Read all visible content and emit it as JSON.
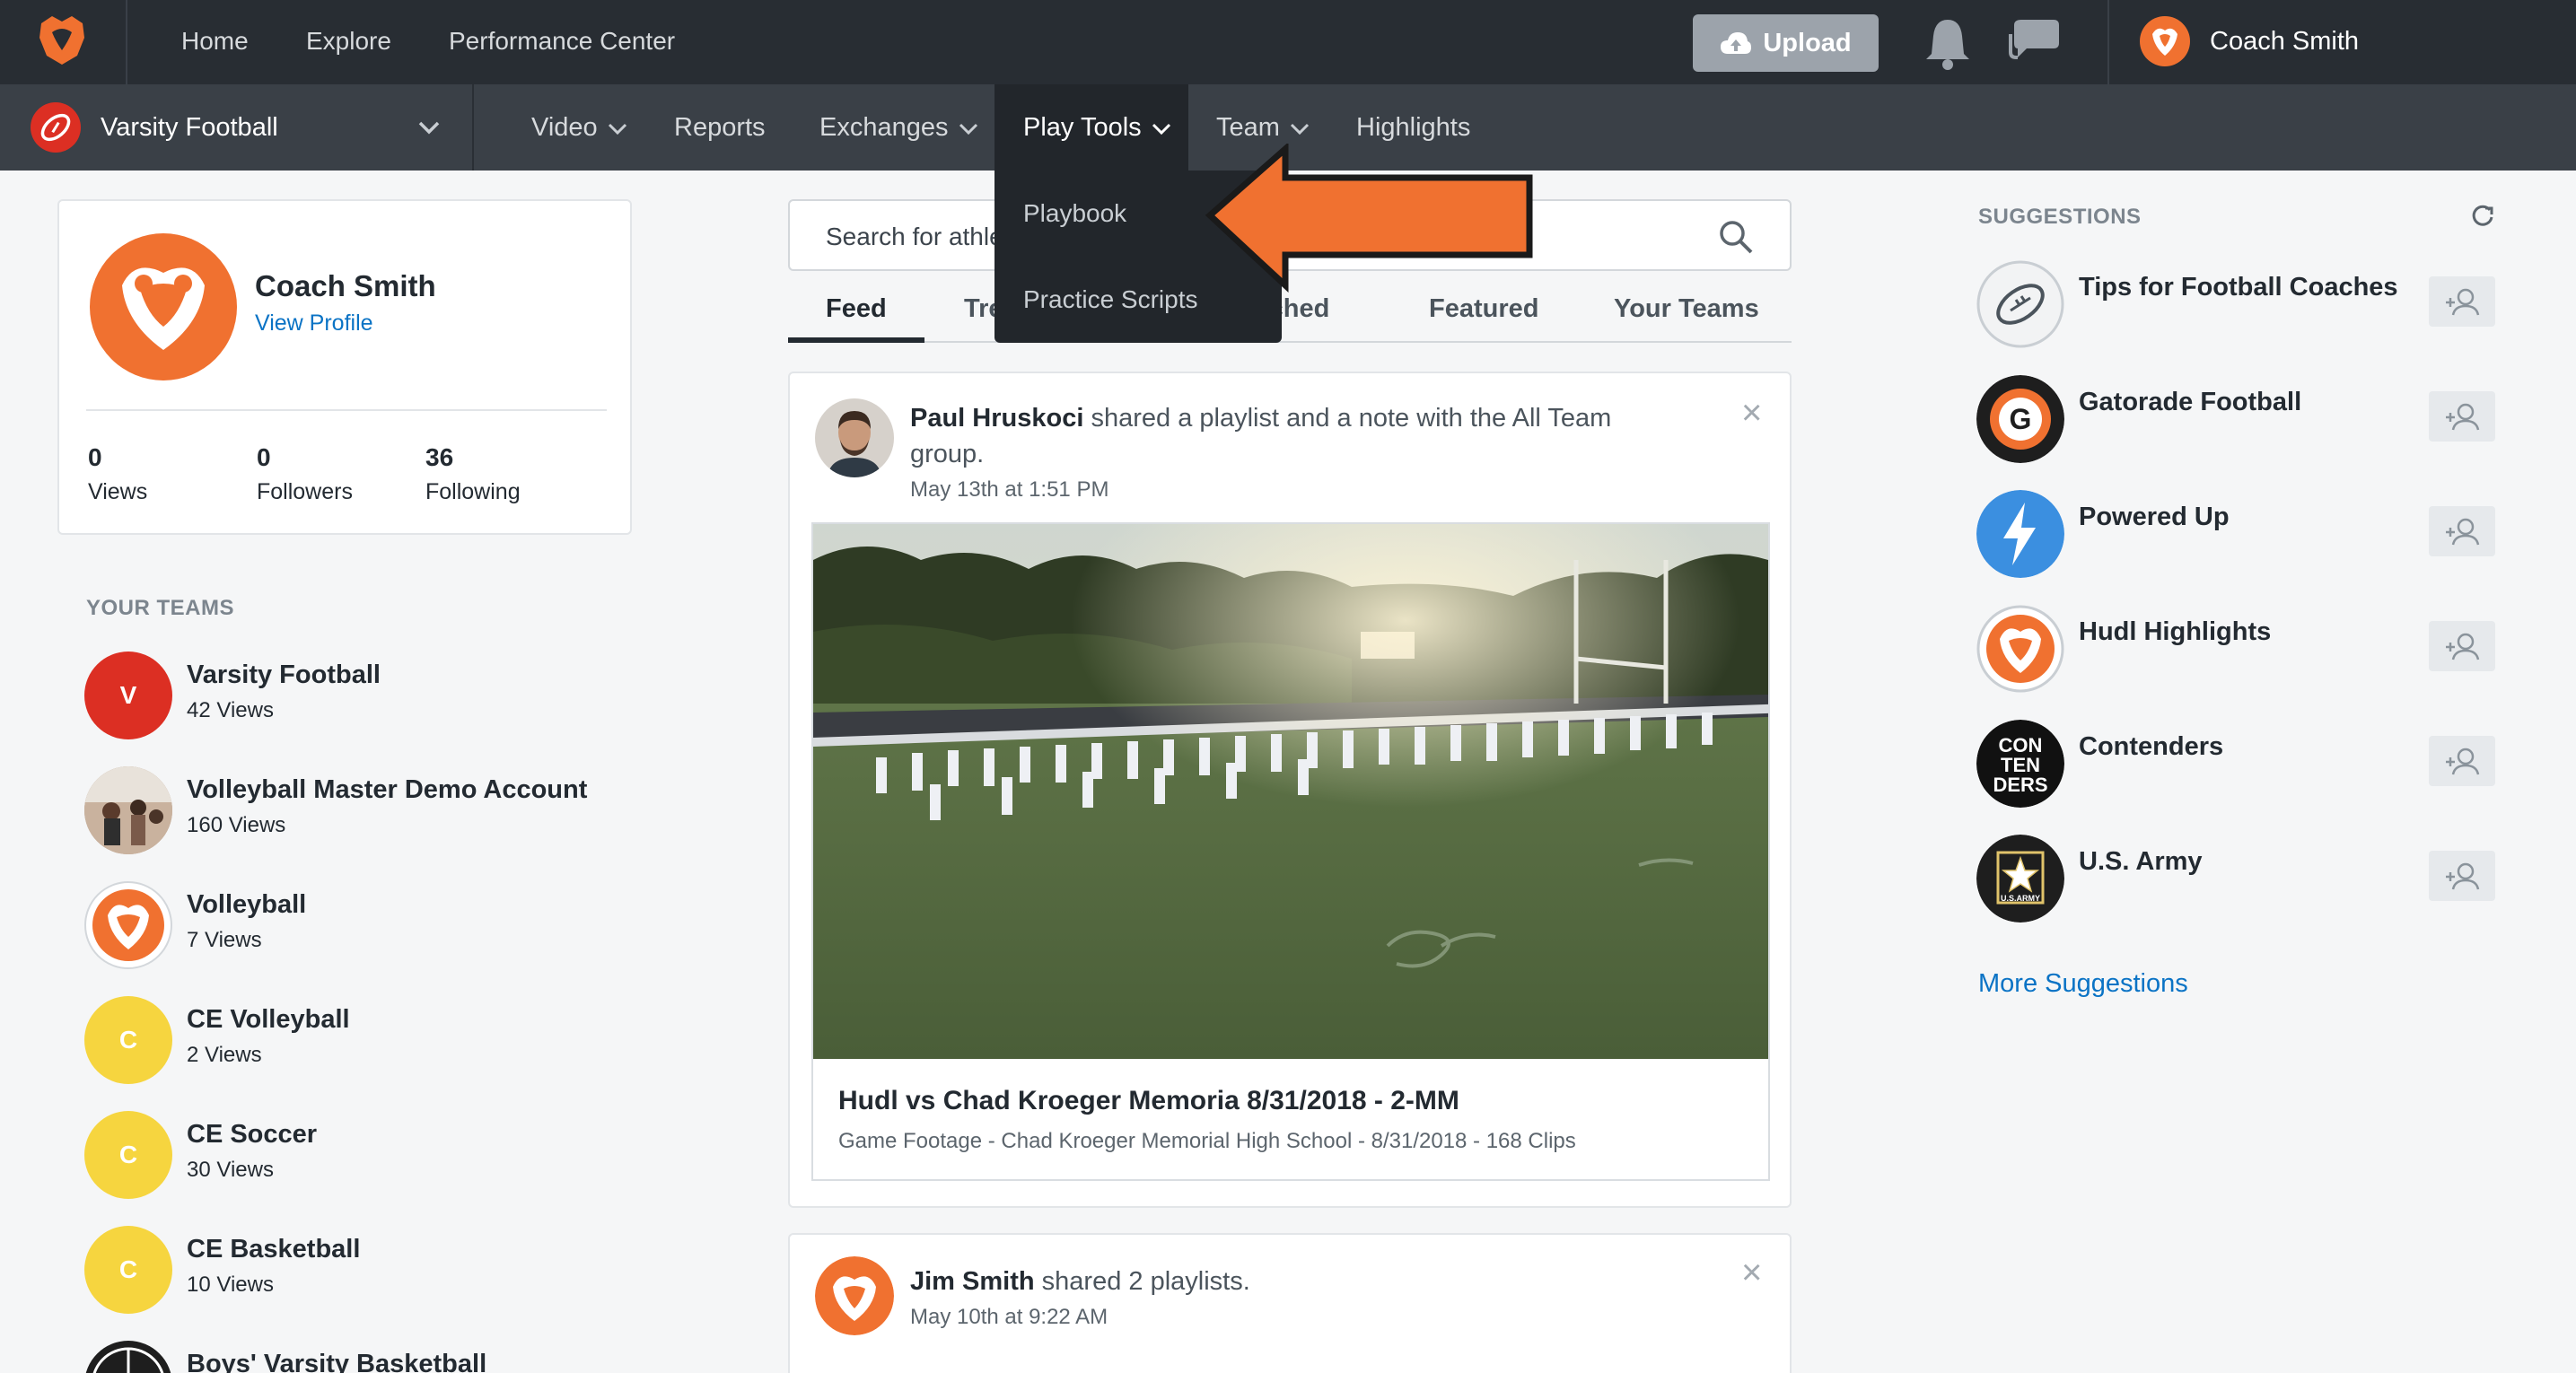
{
  "topbar": {
    "nav": [
      "Home",
      "Explore",
      "Performance Center"
    ],
    "upload_label": "Upload",
    "user_name": "Coach Smith"
  },
  "subnav": {
    "team": "Varsity Football",
    "items": [
      "Video",
      "Reports",
      "Exchanges",
      "Play Tools",
      "Team",
      "Highlights"
    ],
    "active": "Play Tools"
  },
  "dropdown": {
    "items": [
      "Playbook",
      "Practice Scripts"
    ]
  },
  "annotation": {
    "arrow_color": "#f07130"
  },
  "profile": {
    "name": "Coach Smith",
    "link": "View Profile",
    "stats": [
      {
        "value": "0",
        "label": "Views"
      },
      {
        "value": "0",
        "label": "Followers"
      },
      {
        "value": "36",
        "label": "Following"
      }
    ]
  },
  "your_teams": {
    "title": "YOUR TEAMS",
    "items": [
      {
        "name": "Varsity Football",
        "views": "42 Views",
        "initial": "V",
        "color": "#dc2f23"
      },
      {
        "name": "Volleyball Master Demo Account",
        "views": "160 Views",
        "initial": "",
        "color": "#b89b86"
      },
      {
        "name": "Volleyball",
        "views": "7 Views",
        "initial": "",
        "color": "#ffffff"
      },
      {
        "name": "CE Volleyball",
        "views": "2 Views",
        "initial": "C",
        "color": "#f6d53f"
      },
      {
        "name": "CE Soccer",
        "views": "30 Views",
        "initial": "C",
        "color": "#f6d53f"
      },
      {
        "name": "CE Basketball",
        "views": "10 Views",
        "initial": "C",
        "color": "#f6d53f"
      },
      {
        "name": "Boys' Varsity Basketball",
        "views": "",
        "initial": "",
        "color": "#1e1e1e"
      }
    ]
  },
  "search": {
    "placeholder": "Search for athle"
  },
  "feed_tabs": [
    "Feed",
    "Tre",
    "tched",
    "Featured",
    "Your Teams"
  ],
  "posts": [
    {
      "author": "Paul Hruskoci",
      "text": " shared a playlist and a note with the All Team group.",
      "date": "May 13th at 1:51 PM",
      "video_title": "Hudl vs Chad Kroeger Memoria 8/31/2018 - 2-MM",
      "video_sub": "Game Footage - Chad Kroeger Memorial High School - 8/31/2018 - 168 Clips"
    },
    {
      "author": "Jim Smith",
      "text": " shared 2 playlists.",
      "date": "May 10th at 9:22 AM"
    }
  ],
  "suggestions": {
    "title": "SUGGESTIONS",
    "items": [
      {
        "name": "Tips for Football Coaches",
        "icon": "football-icon"
      },
      {
        "name": "Gatorade Football",
        "icon": "gatorade-icon"
      },
      {
        "name": "Powered Up",
        "icon": "lightning-icon"
      },
      {
        "name": "Hudl Highlights",
        "icon": "hudl-icon"
      },
      {
        "name": "Contenders",
        "icon": "contenders-icon"
      },
      {
        "name": "U.S. Army",
        "icon": "army-star-icon"
      }
    ],
    "more": "More Suggestions",
    "contenders_text": [
      "CON",
      "TEN",
      "DERS"
    ],
    "army_text": "U.S.ARMY",
    "gatorade_letter": "G"
  },
  "colors": {
    "brand": "#f07130",
    "link": "#0a73c5",
    "topbar": "#282d33"
  }
}
